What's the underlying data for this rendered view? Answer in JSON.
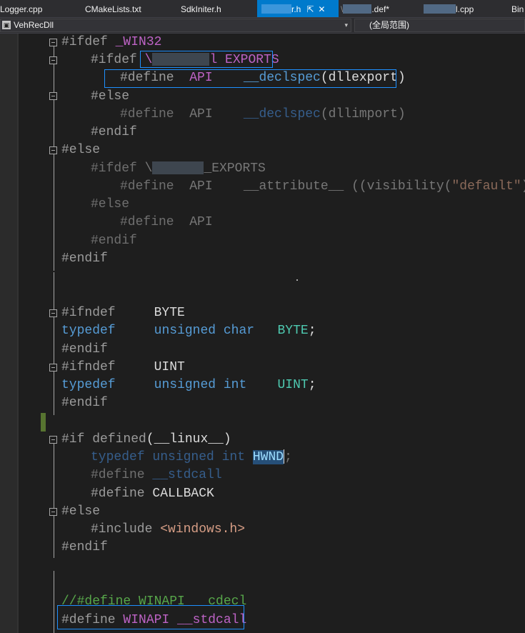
{
  "tabs": [
    {
      "label": "Logger.cpp"
    },
    {
      "label": "CMakeLists.txt"
    },
    {
      "label": "SdkIniter.h"
    },
    {
      "label": "r.h",
      "active": true,
      "pin_icon": "pin-icon",
      "close_icon": "close-icon"
    },
    {
      "label": ".def*"
    },
    {
      "label": "l.cpp"
    },
    {
      "label": "Bin"
    }
  ],
  "navbar": {
    "project": "VehRecDll",
    "scope": "(全局范围)"
  },
  "code": {
    "l1_a": "#ifdef ",
    "l1_b": "_WIN32",
    "l2_a": "#ifdef ",
    "l2_b": "l EXPORTS",
    "l3_a": "#define  ",
    "l3_b": "API",
    "l3_c": "    ",
    "l3_d": "__declspec",
    "l3_e": "(dllexport)",
    "l4": "#else",
    "l5_a": "#define  ",
    "l5_b": "API    ",
    "l5_c": "__declspec",
    "l5_d": "(dllimport)",
    "l6": "#endif",
    "l7": "#else",
    "l8_a": "#ifdef ",
    "l8_b": "_EXPORTS",
    "l9_a": "#define  ",
    "l9_b": "API    ",
    "l9_c": "__attribute__ ((visibility(",
    "l9_d": "\"default\"",
    "l9_e": ")))",
    "l10": "#else",
    "l11_a": "#define  ",
    "l11_b": "API",
    "l12": "#endif",
    "l13": "#endif",
    "l14_a": "#ifndef     ",
    "l14_b": "BYTE",
    "l15_a": "typedef",
    "l15_b": "     ",
    "l15_c": "unsigned char",
    "l15_d": "   ",
    "l15_e": "BYTE",
    "l15_f": ";",
    "l16": "#endif",
    "l17_a": "#ifndef     ",
    "l17_b": "UINT",
    "l18_a": "typedef",
    "l18_b": "     ",
    "l18_c": "unsigned int",
    "l18_d": "    ",
    "l18_e": "UINT",
    "l18_f": ";",
    "l19": "#endif",
    "l20_a": "#if ",
    "l20_b": "defined",
    "l20_c": "(__linux__)",
    "l21_a": "typedef unsigned int ",
    "l21_b": "HWND",
    "l21_c": ";",
    "l22_a": "#define ",
    "l22_b": "__stdcall",
    "l23_a": "#define ",
    "l23_b": "CALLBACK",
    "l24": "#else",
    "l25_a": "#include ",
    "l25_b": "<windows.h>",
    "l26": "#endif",
    "l27": "//#define WINAPI __cdecl",
    "l28_a": "#define ",
    "l28_b": "WINAPI",
    "l28_c": " __stdcall"
  }
}
